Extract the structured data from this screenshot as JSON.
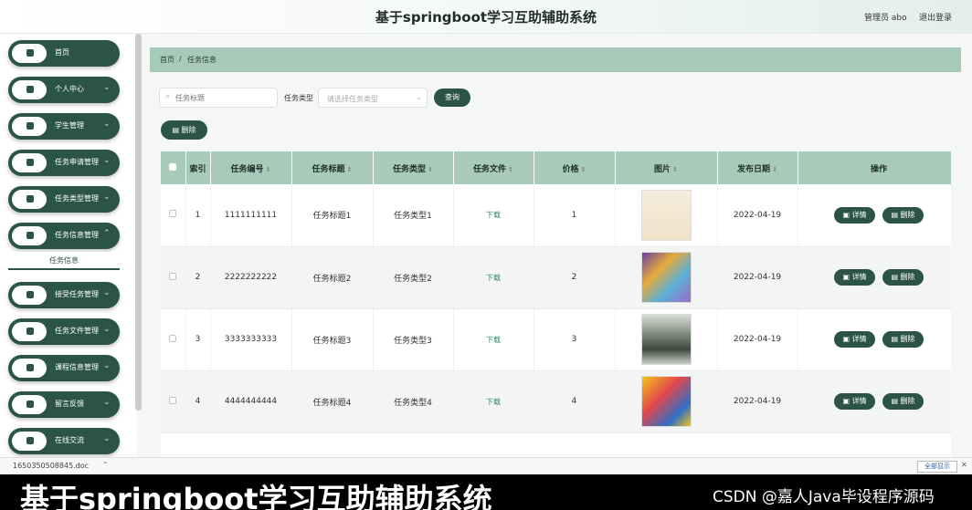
{
  "header": {
    "title": "基于springboot学习互助辅助系统",
    "admin": "管理员 abo",
    "logout": "退出登录"
  },
  "sidebar": {
    "items": [
      {
        "label": "首页",
        "icon": "home-icon",
        "chevron": false
      },
      {
        "label": "个人中心",
        "icon": "user-icon",
        "chevron": true
      },
      {
        "label": "学生管理",
        "icon": "briefcase-icon",
        "chevron": true
      },
      {
        "label": "任务申请管理",
        "icon": "grid-icon",
        "chevron": true
      },
      {
        "label": "任务类型管理",
        "icon": "trash-icon",
        "chevron": true
      },
      {
        "label": "任务信息管理",
        "icon": "grid-icon",
        "chevron": true
      },
      {
        "label": "接受任务管理",
        "icon": "upload-icon",
        "chevron": true
      },
      {
        "label": "任务文件管理",
        "icon": "user-icon",
        "chevron": true
      },
      {
        "label": "课程信息管理",
        "icon": "grid-icon",
        "chevron": true
      },
      {
        "label": "留言反馈",
        "icon": "grid-icon",
        "chevron": true
      },
      {
        "label": "在线交流",
        "icon": "grid-icon",
        "chevron": true
      }
    ],
    "active_sub": "任务信息"
  },
  "breadcrumb": {
    "home": "首页",
    "sep": "/",
    "current": "任务信息"
  },
  "filters": {
    "search_placeholder": "任务标题",
    "type_label": "任务类型",
    "type_placeholder": "请选择任务类型",
    "query_button": "查询",
    "delete_button": "删除"
  },
  "table": {
    "headers": [
      "索引",
      "任务编号",
      "任务标题",
      "任务类型",
      "任务文件",
      "价格",
      "图片",
      "发布日期",
      "操作"
    ],
    "rows": [
      {
        "index": "1",
        "code": "1111111111",
        "title": "任务标题1",
        "type": "任务类型1",
        "file": "下载",
        "price": "1",
        "date": "2022-04-19"
      },
      {
        "index": "2",
        "code": "2222222222",
        "title": "任务标题2",
        "type": "任务类型2",
        "file": "下载",
        "price": "2",
        "date": "2022-04-19"
      },
      {
        "index": "3",
        "code": "3333333333",
        "title": "任务标题3",
        "type": "任务类型3",
        "file": "下载",
        "price": "3",
        "date": "2022-04-19"
      },
      {
        "index": "4",
        "code": "4444444444",
        "title": "任务标题4",
        "type": "任务类型4",
        "file": "下载",
        "price": "4",
        "date": "2022-04-19"
      }
    ],
    "detail_label": "详情",
    "delete_label": "删除"
  },
  "download_bar": {
    "filename": "1650350508845.doc",
    "show_all": "全部显示"
  },
  "caption": {
    "title": "基于springboot学习互助辅助系统",
    "watermark": "CSDN @嘉人Java毕设程序源码"
  },
  "colors": {
    "primary": "#2b5446",
    "header_bg": "#a8cabb"
  }
}
